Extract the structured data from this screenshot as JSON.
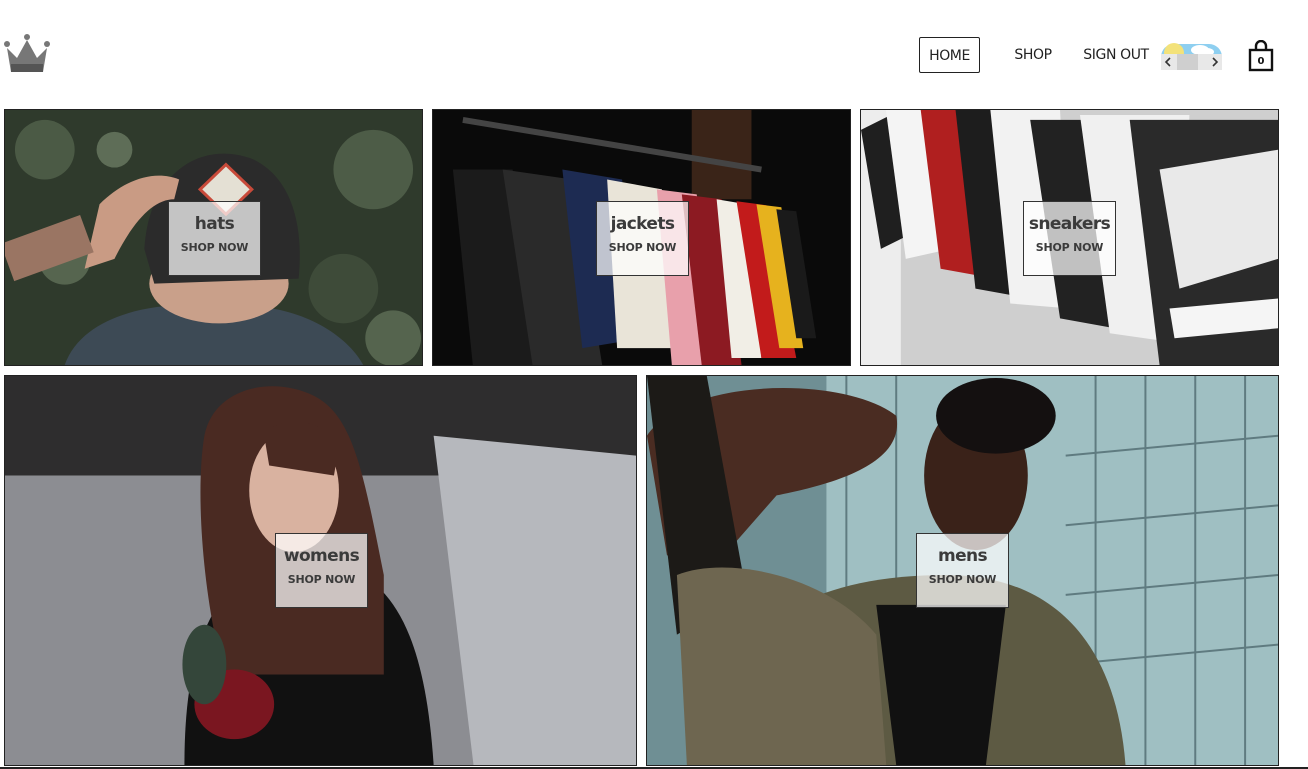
{
  "header": {
    "logo": "crown-logo",
    "nav": [
      {
        "label": "HOME",
        "active": true
      },
      {
        "label": "SHOP",
        "active": false
      },
      {
        "label": "SIGN OUT",
        "active": false
      }
    ],
    "weather_widget": "weather-icon",
    "cart": {
      "icon": "shopping-bag-icon",
      "count": "0"
    }
  },
  "categories": [
    {
      "title": "hats",
      "cta": "SHOP NOW"
    },
    {
      "title": "jackets",
      "cta": "SHOP NOW"
    },
    {
      "title": "sneakers",
      "cta": "SHOP NOW"
    },
    {
      "title": "womens",
      "cta": "SHOP NOW"
    },
    {
      "title": "mens",
      "cta": "SHOP NOW"
    }
  ],
  "colors": {
    "border": "#222222",
    "label_bg": "#ffffffb8",
    "text": "#3b3b3b"
  }
}
